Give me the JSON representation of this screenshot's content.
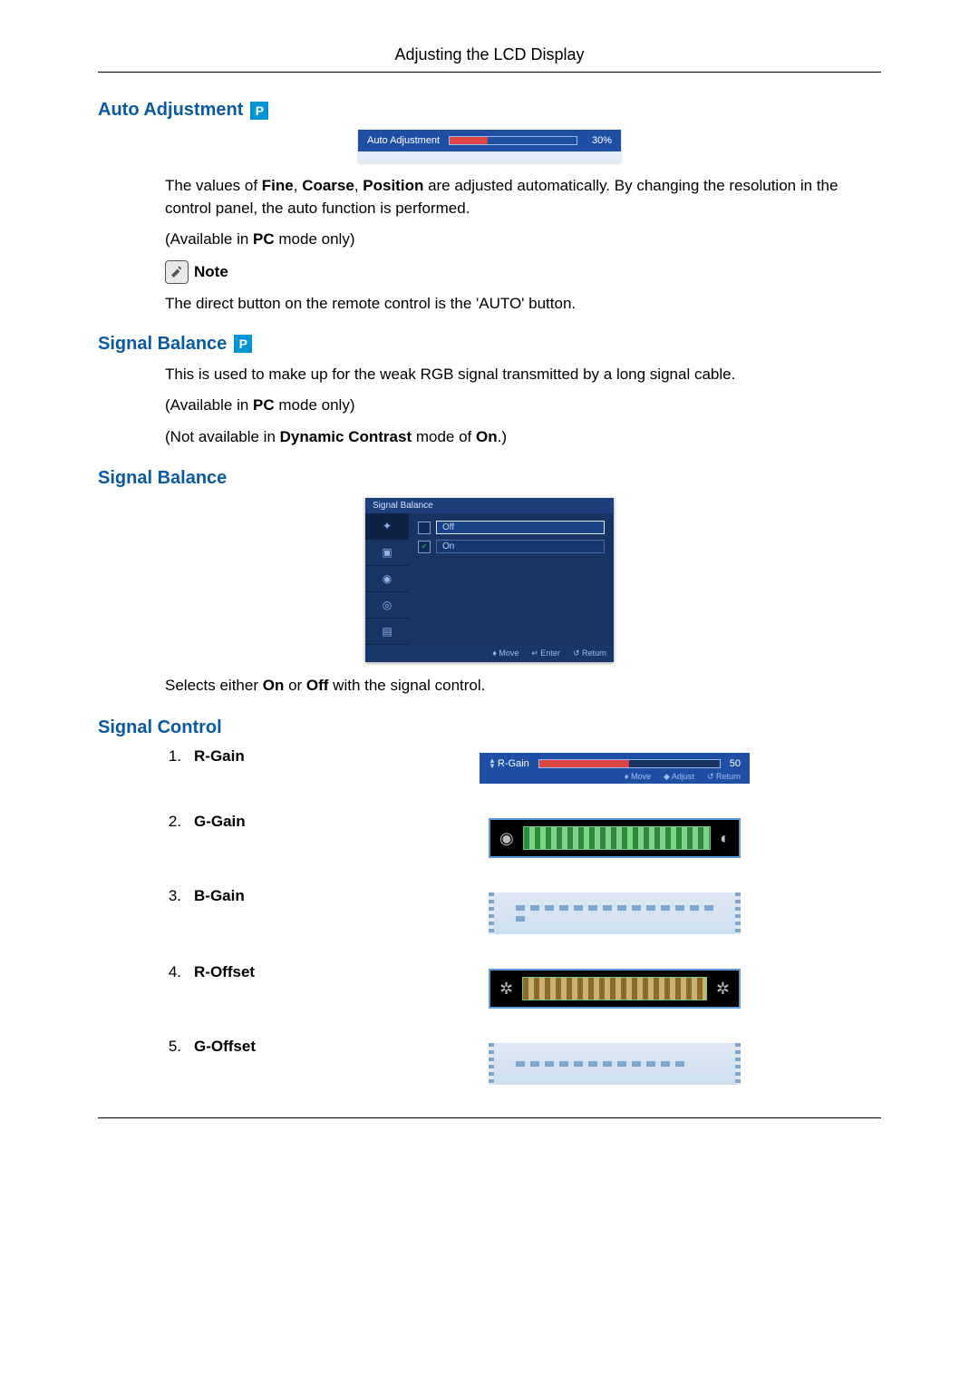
{
  "page_title": "Adjusting the LCD Display",
  "badge": "P",
  "auto_adjustment": {
    "heading": "Auto Adjustment",
    "osd_label": "Auto Adjustment",
    "osd_value": "30%",
    "para1_prefix": "The values of ",
    "bold_fine": "Fine",
    "sep1": ", ",
    "bold_coarse": "Coarse",
    "sep2": ", ",
    "bold_position": "Position",
    "para1_suffix": " are adjusted automatically. By changing the resolution in the control panel, the auto function is performed.",
    "avail_prefix": "(Available in ",
    "bold_pc": "PC",
    "avail_suffix": " mode only)",
    "note_label": "Note",
    "note_text": "The direct button on the remote control is the 'AUTO' button."
  },
  "signal_balance_intro": {
    "heading": "Signal Balance",
    "para1": "This is used to make up for the weak RGB signal transmitted by a long signal cable.",
    "avail_prefix": "(Available in ",
    "bold_pc": "PC",
    "avail_suffix": " mode only)",
    "notavail_prefix": "(Not available in ",
    "bold_dc": "Dynamic Contrast",
    "notavail_mid": " mode of ",
    "bold_on": "On",
    "notavail_suffix": ".)"
  },
  "signal_balance_menu": {
    "heading": "Signal Balance",
    "osd_title": "Signal Balance",
    "options": {
      "off": "Off",
      "on": "On"
    },
    "footer": {
      "move": "Move",
      "enter": "Enter",
      "return": "Return"
    },
    "para_prefix": "Selects either ",
    "bold_on": "On",
    "para_mid": " or ",
    "bold_off": "Off",
    "para_suffix": " with the signal control."
  },
  "signal_control": {
    "heading": "Signal Control",
    "items": [
      {
        "num": "1.",
        "label": "R-Gain"
      },
      {
        "num": "2.",
        "label": "G-Gain"
      },
      {
        "num": "3.",
        "label": "B-Gain"
      },
      {
        "num": "4.",
        "label": "R-Offset"
      },
      {
        "num": "5.",
        "label": "G-Offset"
      }
    ],
    "rgain_osd": {
      "label": "R-Gain",
      "value": "50",
      "footer": {
        "move": "Move",
        "adjust": "Adjust",
        "return": "Return"
      }
    }
  }
}
